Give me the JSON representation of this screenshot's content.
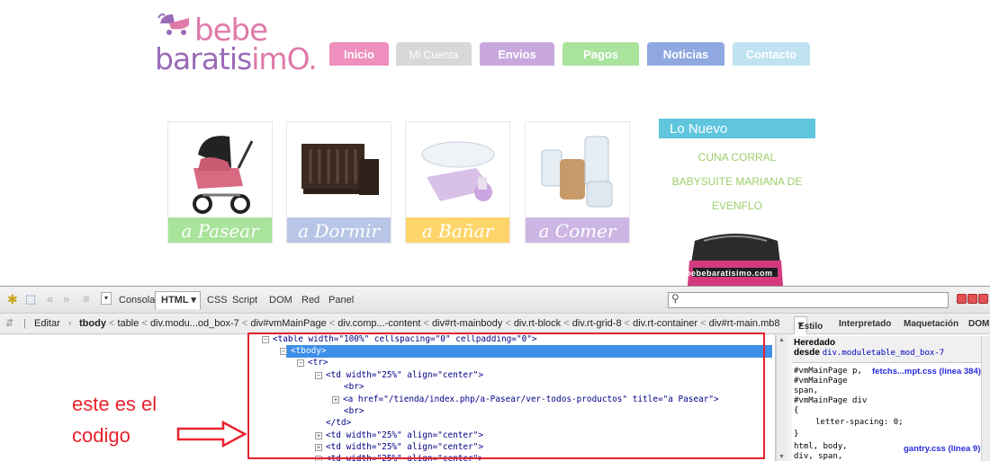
{
  "site": {
    "logo": {
      "line1": "bebe",
      "line2a": "baratis",
      "line2b": "imO."
    },
    "nav": [
      "Inicio",
      "Mi Cuenta",
      "Envios",
      "Pagos",
      "Noticias",
      "Contacto"
    ],
    "tiles": [
      "a Pasear",
      "a Dormir",
      "a Bañar",
      "a Comer"
    ],
    "news": {
      "title": "Lo Nuevo",
      "lines": [
        "CUNA CORRAL",
        "BABYSUITE MARIANA DE",
        "EVENFLO"
      ],
      "image_caption": "bebebaratisimo.com"
    }
  },
  "firebug": {
    "toolbar": {
      "consola": "Consola",
      "html": "HTML",
      "css": "CSS",
      "script": "Script",
      "dom": "DOM",
      "red": "Red",
      "panel": "Panel"
    },
    "breadcrumb": {
      "edit": "Editar",
      "current": "tbody",
      "items": [
        "table",
        "div.modu...od_box-7",
        "div#vmMainPage",
        "div.comp...-content",
        "div#rt-mainbody",
        "div.rt-block",
        "div.rt-grid-8",
        "div.rt-container",
        "div#rt-main.mb8"
      ]
    },
    "code": {
      "table_line": "<table width=\"100%\" cellspacing=\"0\" cellpadding=\"0\">",
      "tbody": "<tbody>",
      "tr": "<tr>",
      "td_open": "<td width=\"25%\" align=\"center\">",
      "br": "<br>",
      "a_line": "<a href=\"/tienda/index.php/a-Pasear/ver-todos-productos\" title=\"a Pasear\">",
      "td_close": "</td>"
    },
    "side": {
      "tabs": [
        "Estilo",
        "Interpretado",
        "Maquetación",
        "DOM"
      ],
      "inherited_title": "Heredado",
      "inherited_from": "desde",
      "inherited_selector": "div.moduletable_mod_box-7",
      "rule1_selectors": [
        "#vmMainPage p,",
        "#vmMainPage",
        "span,",
        "#vmMainPage div"
      ],
      "rule1_open": "{",
      "rule1_prop": "letter-spacing: 0;",
      "rule1_close": "}",
      "rule1_link": "fetchs...mpt.css (línea 384)",
      "rule2_selectors": [
        "html, body,",
        "div, span,"
      ],
      "rule2_link": "gantry.css (línea 9)"
    }
  },
  "annotation": {
    "line1": "este es el",
    "line2": "codigo"
  }
}
